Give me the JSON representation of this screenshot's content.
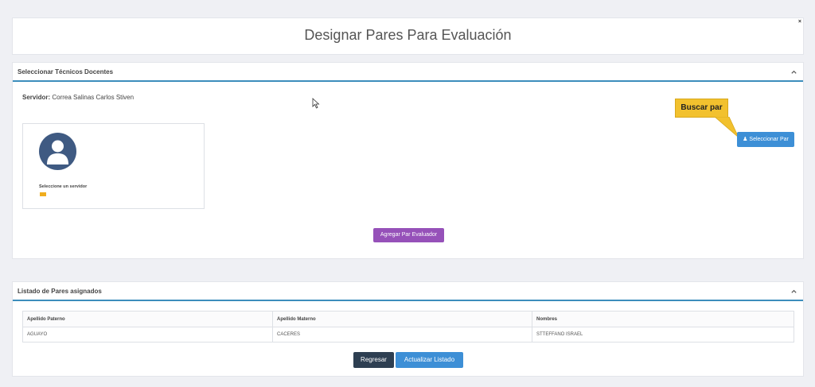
{
  "header": {
    "title": "Designar Pares Para Evaluación",
    "close": "×"
  },
  "tech_section": {
    "title": "Seleccionar Técnicos Docentes",
    "servidor_label": "Servidor:",
    "servidor_value": "Correa Salinas Carlos Stiven",
    "card_text": "Seleccione un servidor",
    "tooltip": "Buscar par",
    "select_button": "Seleccionar Par",
    "add_button": "Agregar Par Evaluador"
  },
  "list_section": {
    "title": "Listado de Pares asignados",
    "columns": [
      "Apellido Paterno",
      "Apellido Materno",
      "Nombres"
    ],
    "rows": [
      [
        "AGUAYO",
        "CACERES",
        "STTEFFANO ISRAEL"
      ]
    ],
    "back_button": "Regresar",
    "refresh_button": "Actualizar Listado"
  },
  "colors": {
    "accent": "#3c8dbc",
    "primary_button": "#3d8fd6",
    "purple_button": "#9651b9",
    "dark_button": "#2e3f52",
    "tooltip": "#f2c12e"
  }
}
